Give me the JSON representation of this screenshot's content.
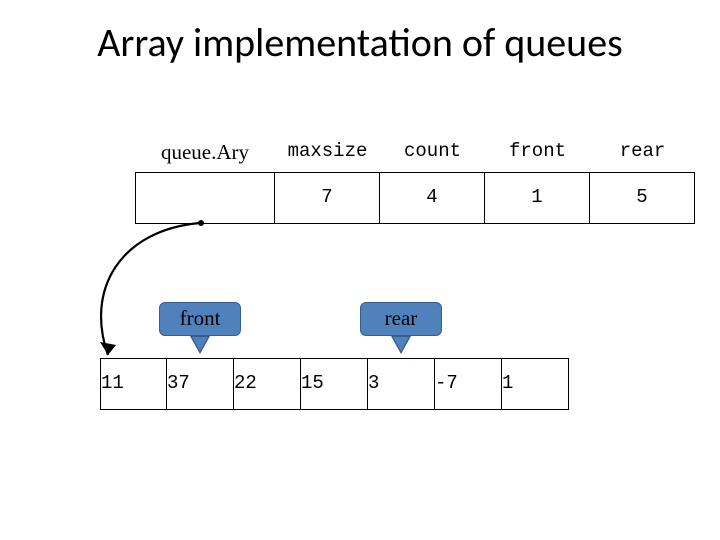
{
  "title": "Array implementation of queues",
  "struct": {
    "colLabels": [
      "queue.Ary",
      "maxsize",
      "count",
      "front",
      "rear"
    ],
    "values": [
      "",
      "7",
      "4",
      "1",
      "5"
    ]
  },
  "callouts": {
    "front": "front",
    "rear": "rear"
  },
  "array": [
    "11",
    "37",
    "22",
    "15",
    "3",
    "-7",
    "1"
  ]
}
